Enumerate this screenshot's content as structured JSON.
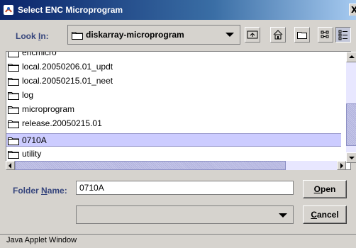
{
  "window": {
    "title": "Select ENC Microprogram",
    "close_label": "X"
  },
  "look_in": {
    "label_prefix": "Look ",
    "label_mnemonic": "I",
    "label_suffix": "n:",
    "current_folder": "diskarray-microprogram"
  },
  "toolbar": {
    "icons": [
      "up-one-level-icon",
      "home-icon",
      "new-folder-icon",
      "list-view-icon",
      "details-view-icon"
    ]
  },
  "file_list": {
    "items": [
      {
        "name": "encmicro",
        "selected": false
      },
      {
        "name": "local.20050206.01_updt",
        "selected": false
      },
      {
        "name": "local.20050215.01_neet",
        "selected": false
      },
      {
        "name": "log",
        "selected": false
      },
      {
        "name": "microprogram",
        "selected": false
      },
      {
        "name": "release.20050215.01",
        "selected": false
      },
      {
        "name": "0710A",
        "selected": true
      },
      {
        "name": "utility",
        "selected": false
      }
    ]
  },
  "folder_name": {
    "label_prefix": "Folder ",
    "label_mnemonic": "N",
    "label_suffix": "ame:",
    "value": "0710A"
  },
  "buttons": {
    "open_mnemonic": "O",
    "open_rest": "pen",
    "cancel_mnemonic": "C",
    "cancel_rest": "ancel"
  },
  "file_type": {
    "selected": ""
  },
  "status_bar": {
    "text": "Java Applet Window"
  },
  "colors": {
    "title_bar": "#0a246a",
    "selection": "#ccccff",
    "label": "#36457c",
    "background": "#d6d3ce"
  }
}
